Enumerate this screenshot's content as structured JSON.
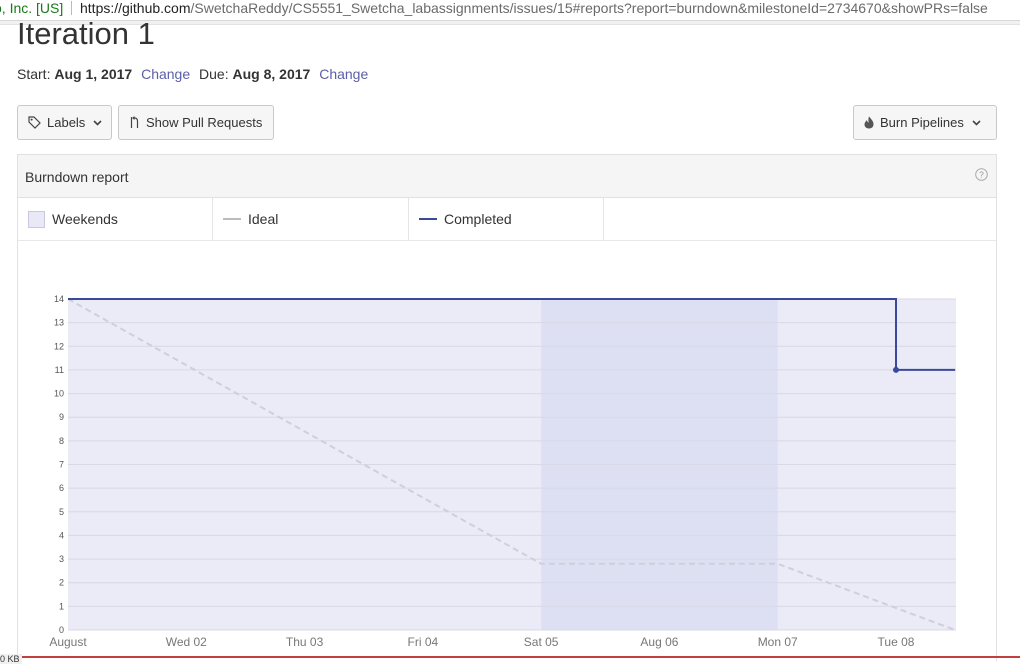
{
  "browser": {
    "cert_label": "o, Inc. [US]",
    "url_host": "https://github.com",
    "url_path": "/SwetchaReddy/CS5551_Swetcha_labassignments/issues/15#reports?report=burndown&milestoneId=2734670&showPRs=false"
  },
  "page": {
    "title": "Iteration 1",
    "start_label": "Start:",
    "start_date": "Aug 1, 2017",
    "change_start": "Change",
    "due_label": "Due:",
    "due_date": "Aug 8, 2017",
    "change_due": "Change"
  },
  "toolbar": {
    "labels_button": "Labels",
    "pull_requests_button": "Show Pull Requests",
    "burn_pipelines_button": "Burn Pipelines"
  },
  "report": {
    "title": "Burndown report",
    "legend": [
      {
        "label": "Weekends",
        "color": "#e8e8f6"
      },
      {
        "label": "Ideal",
        "color": "#bbbbbb"
      },
      {
        "label": "Completed",
        "color": "#3a4a9a"
      }
    ]
  },
  "status_text": "0 KB",
  "colors": {
    "link": "#5b5fa8",
    "plot_bg": "#ebebf7",
    "weekend_bg": "#dde0f2",
    "completed": "#3a4a9a",
    "ideal": "#cfcfdc",
    "grid": "#d8d8e6"
  },
  "chart_data": {
    "type": "line",
    "x_labels": [
      "August",
      "Wed 02",
      "Thu 03",
      "Fri 04",
      "Sat 05",
      "Aug 06",
      "Mon 07",
      "Tue 08"
    ],
    "ylim": [
      0,
      14
    ],
    "y_ticks": [
      0,
      1,
      2,
      3,
      4,
      5,
      6,
      7,
      8,
      9,
      10,
      11,
      12,
      13,
      14
    ],
    "weekend_range": [
      4,
      6
    ],
    "series": [
      {
        "name": "Ideal",
        "style": "dashed",
        "points": [
          [
            0,
            14
          ],
          [
            4,
            2.8
          ],
          [
            6,
            2.8
          ],
          [
            7.5,
            0
          ]
        ]
      },
      {
        "name": "Completed",
        "style": "step",
        "points": [
          [
            0,
            14
          ],
          [
            7,
            14
          ],
          [
            7,
            11
          ],
          [
            7.5,
            11
          ]
        ],
        "markers": [
          [
            7,
            11
          ]
        ]
      }
    ]
  }
}
